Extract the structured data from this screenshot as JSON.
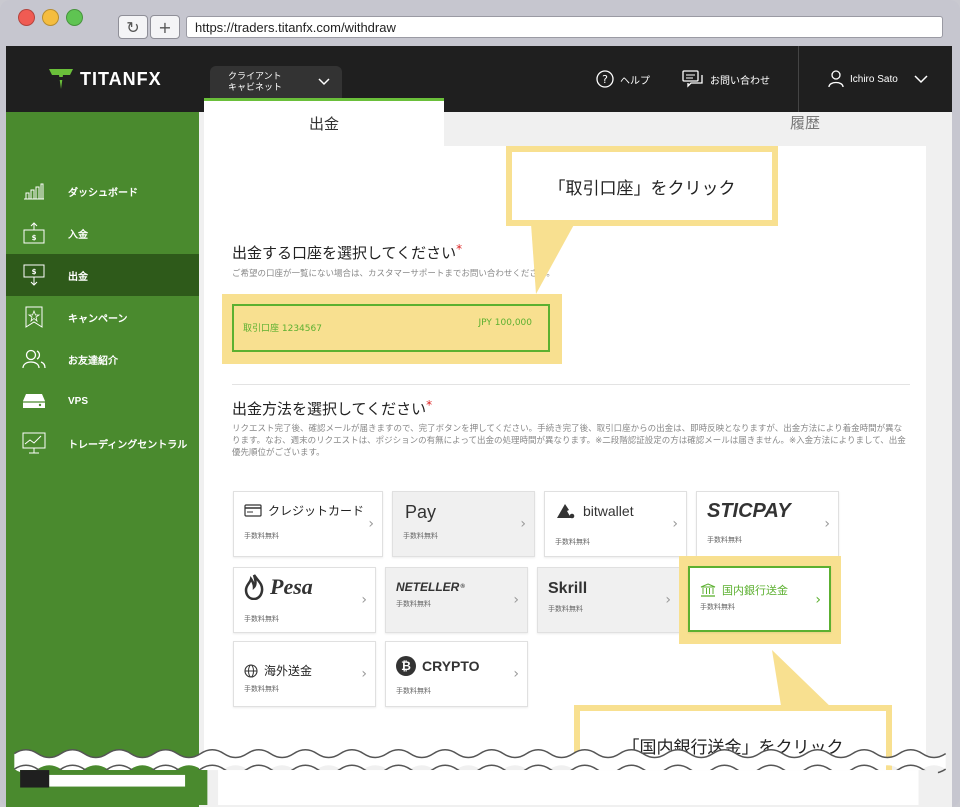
{
  "browser": {
    "url": "https://traders.titanfx.com/withdraw",
    "reload_glyph": "↻",
    "new_tab_glyph": "+"
  },
  "header": {
    "logo": "TITANFX",
    "cabinet_line1": "クライアント",
    "cabinet_line2": "キャビネット",
    "help": "ヘルプ",
    "contact": "お問い合わせ",
    "user": "Ichiro Sato"
  },
  "sidebar": {
    "items": [
      {
        "label": "ダッシュボード",
        "icon": "bar-chart-icon"
      },
      {
        "label": "入金",
        "icon": "deposit-icon"
      },
      {
        "label": "出金",
        "icon": "withdraw-icon"
      },
      {
        "label": "キャンペーン",
        "icon": "ribbon-star-icon"
      },
      {
        "label": "お友達紹介",
        "icon": "users-icon"
      },
      {
        "label": "VPS",
        "icon": "server-icon"
      },
      {
        "label": "トレーディングセントラル",
        "icon": "monitor-chart-icon"
      }
    ]
  },
  "tabs": {
    "withdraw": "出金",
    "history": "履歴"
  },
  "account_section": {
    "title": "出金する口座を選択してください",
    "required": "*",
    "note": "ご希望の口座が一覧にない場合は、カスタマーサポートまでお問い合わせください。",
    "account_name": "取引口座 1234567",
    "account_balance": "JPY 100,000"
  },
  "method_section": {
    "title": "出金方法を選択してください",
    "required": "*",
    "note": "リクエスト完了後、確認メールが届きますので、完了ボタンを押してください。手続き完了後、取引口座からの出金は、即時反映となりますが、出金方法により着金時間が異なります。なお、週末のリクエストは、ポジションの有無によって出金の処理時間が異なります。※二段階認証設定の方は確認メールは届きません。※入金方法によりまして、出金優先順位がございます。",
    "fee_label": "手数料無料",
    "methods": [
      {
        "name": "クレジットカード"
      },
      {
        "name": "Pay",
        "apple_glyph": ""
      },
      {
        "name": "bitwallet"
      },
      {
        "name": "STICPAY"
      },
      {
        "name": "Pesa"
      },
      {
        "name": "NETELLER",
        "mark": "®"
      },
      {
        "name": "Skrill"
      },
      {
        "name": "国内銀行送金"
      },
      {
        "name": "海外送金"
      },
      {
        "name": "CRYPTO",
        "coin_glyph": "₿"
      }
    ]
  },
  "callouts": {
    "account": "「取引口座」をクリック",
    "bank": "「国内銀行送金」をクリック"
  },
  "colors": {
    "green": "#4a8a2e",
    "accent": "#5cb030",
    "highlight": "#f8e090",
    "dark": "#1f1f1f"
  }
}
